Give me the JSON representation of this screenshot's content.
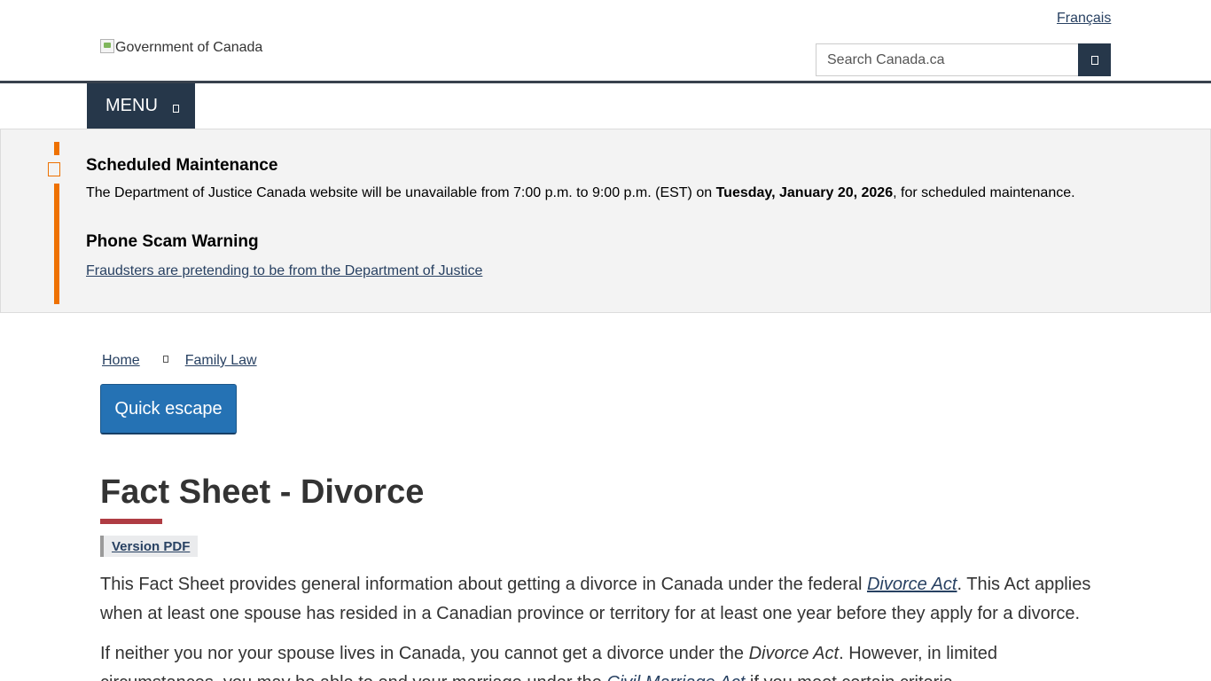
{
  "header": {
    "language_link": "Français",
    "logo_alt": "Government of Canada",
    "search_placeholder": "Search Canada.ca"
  },
  "menu": {
    "label": "MENU"
  },
  "alerts": {
    "maintenance_title": "Scheduled Maintenance",
    "maintenance_text_before": "The Department of Justice Canada website will be unavailable from 7:00 p.m. to 9:00 p.m. (EST) on ",
    "maintenance_date": "Tuesday, January 20, 2026",
    "maintenance_text_after": ", for scheduled maintenance.",
    "scam_title": "Phone Scam Warning",
    "scam_link": "Fraudsters are pretending to be from the Department of Justice"
  },
  "breadcrumb": {
    "items": [
      "Home",
      "Family Law"
    ]
  },
  "quick_escape_label": "Quick escape",
  "page": {
    "title": "Fact Sheet - Divorce",
    "pdf_label": "Version PDF",
    "p1_before": "This Fact Sheet provides general information about getting a divorce in Canada under the federal ",
    "p1_link": "Divorce Act",
    "p1_after": ". This Act applies when at least one spouse has resided in a Canadian province or territory for at least one year before they apply for a divorce.",
    "p2_before": "If neither you nor your spouse lives in Canada, you cannot get a divorce under the ",
    "p2_em": "Divorce Act",
    "p2_middle": ". However, in limited circumstances, you may be able to end your marriage under the ",
    "p2_link": "Civil Marriage Act",
    "p2_after": " if you meet certain criteria."
  },
  "colors": {
    "nav_dark": "#26374a",
    "link": "#284162",
    "alert_accent": "#ee7100",
    "title_rule": "#af3c43",
    "escape_button": "#2572b4"
  },
  "icons": {
    "search_button": "search-icon",
    "menu_button": "chevron-down-icon",
    "breadcrumb_separator": "chevron-right-icon",
    "alert": "warning-icon"
  }
}
